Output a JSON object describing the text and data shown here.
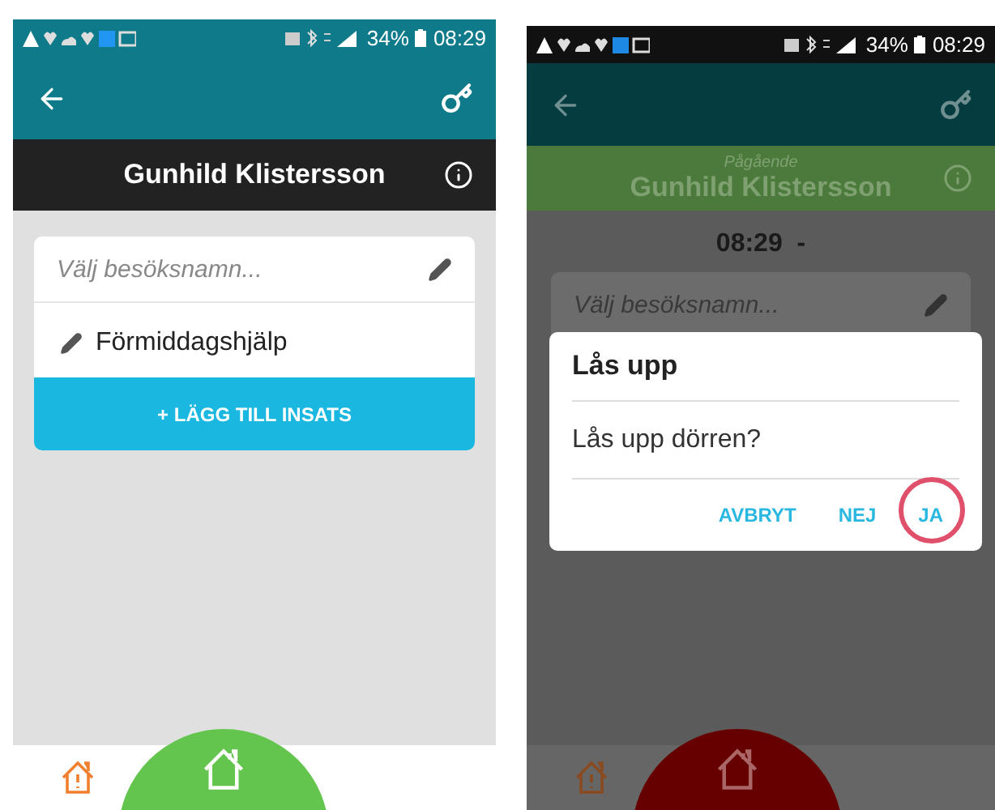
{
  "screens": [
    {
      "dimmed": false,
      "status_bar": {
        "battery": "34%",
        "time": "08:29"
      },
      "header": {
        "kind": "idle",
        "name": "Gunhild Klistersson"
      },
      "card": {
        "placeholder": "Välj besöksnamn...",
        "items": [
          "Förmiddagshjälp"
        ],
        "add_button": "+ LÄGG TILL INSATS"
      },
      "fab": {
        "color": "#63c54e"
      }
    },
    {
      "dimmed": true,
      "status_bar": {
        "battery": "34%",
        "time": "08:29"
      },
      "header": {
        "kind": "ongoing",
        "subtitle": "Pågående",
        "name": "Gunhild Klistersson"
      },
      "time_row": "08:29  -",
      "card": {
        "placeholder": "Välj besöksnamn..."
      },
      "dialog": {
        "title": "Lås upp",
        "message": "Lås upp dörren?",
        "buttons": [
          {
            "label": "AVBRYT",
            "highlighted": false
          },
          {
            "label": "NEJ",
            "highlighted": false
          },
          {
            "label": "JA",
            "highlighted": true
          }
        ]
      },
      "fab": {
        "color": "#660000"
      }
    }
  ]
}
